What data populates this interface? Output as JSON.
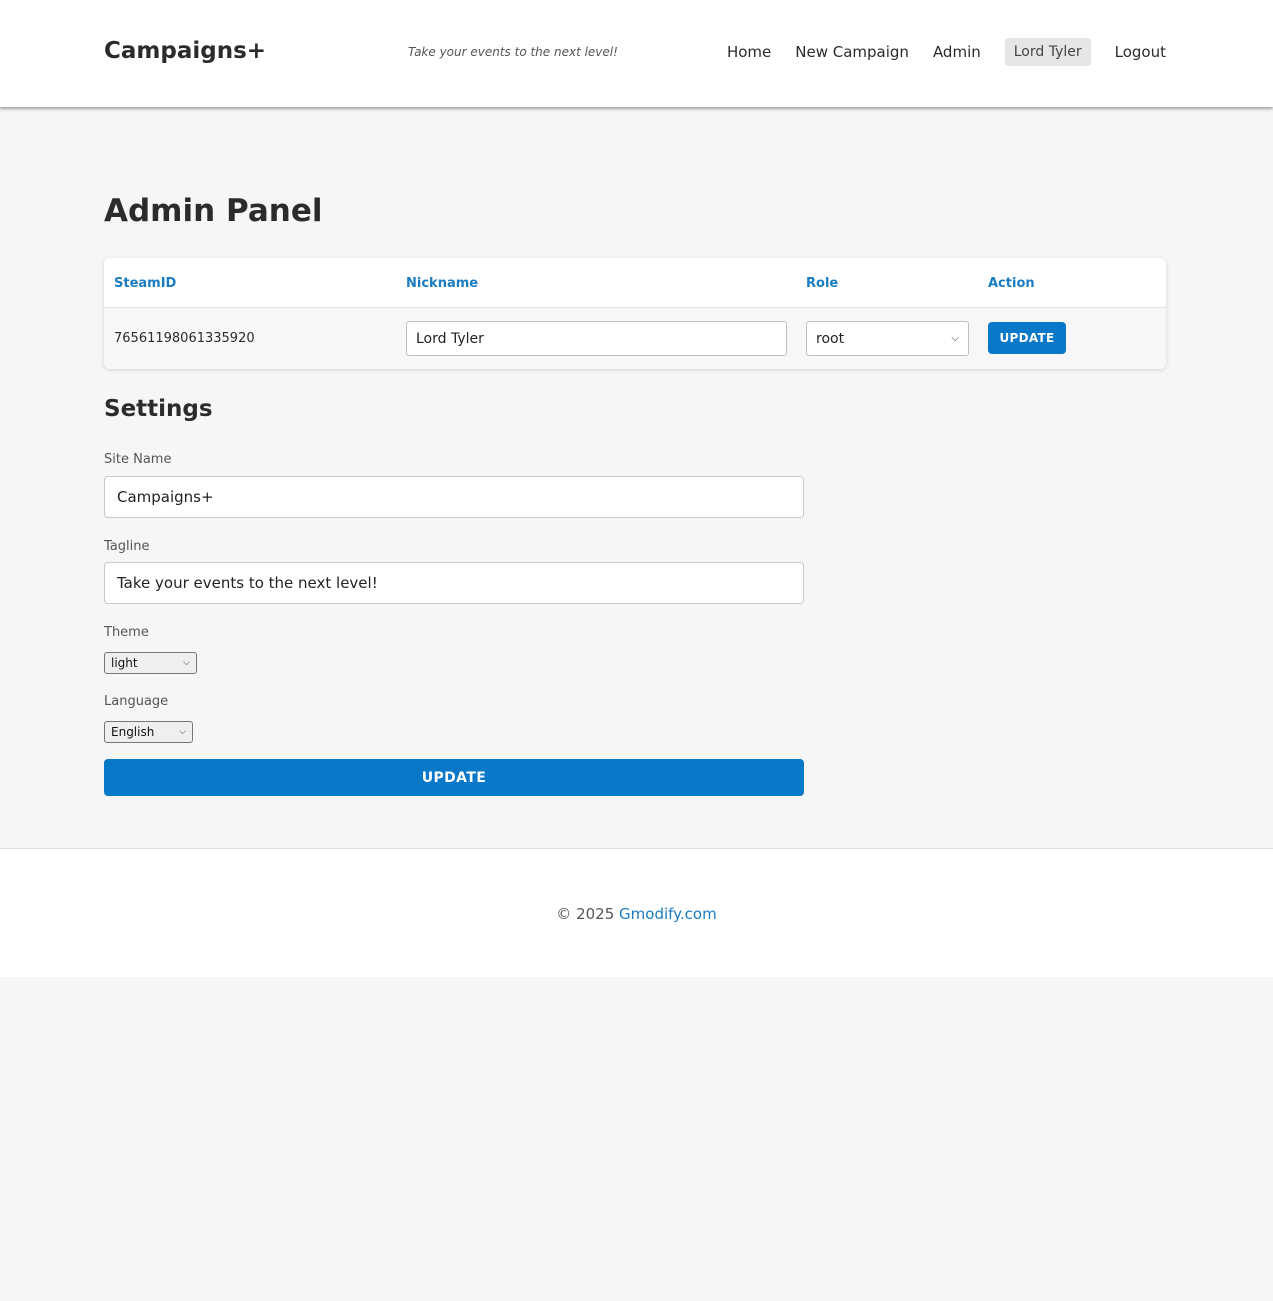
{
  "header": {
    "brand": "Campaigns+",
    "tagline": "Take your events to the next level!",
    "nav": {
      "home": "Home",
      "new_campaign": "New Campaign",
      "admin": "Admin",
      "user": "Lord Tyler",
      "logout": "Logout"
    }
  },
  "page_title": "Admin Panel",
  "users_table": {
    "headers": {
      "steamid": "SteamID",
      "nickname": "Nickname",
      "role": "Role",
      "action": "Action"
    },
    "rows": [
      {
        "steamid": "76561198061335920",
        "nickname": "Lord Tyler",
        "role": "root",
        "action_label": "UPDATE"
      }
    ]
  },
  "settings": {
    "title": "Settings",
    "site_name_label": "Site Name",
    "site_name_value": "Campaigns+",
    "tagline_label": "Tagline",
    "tagline_value": "Take your events to the next level!",
    "theme_label": "Theme",
    "theme_value": "light",
    "language_label": "Language",
    "language_value": "English",
    "update_label": "UPDATE"
  },
  "footer": {
    "copyright": "© 2025",
    "link_text": "Gmodify.com"
  },
  "colors": {
    "accent": "#0a78c8",
    "header_link": "#1a7cc1",
    "background": "#f6f6f6"
  }
}
